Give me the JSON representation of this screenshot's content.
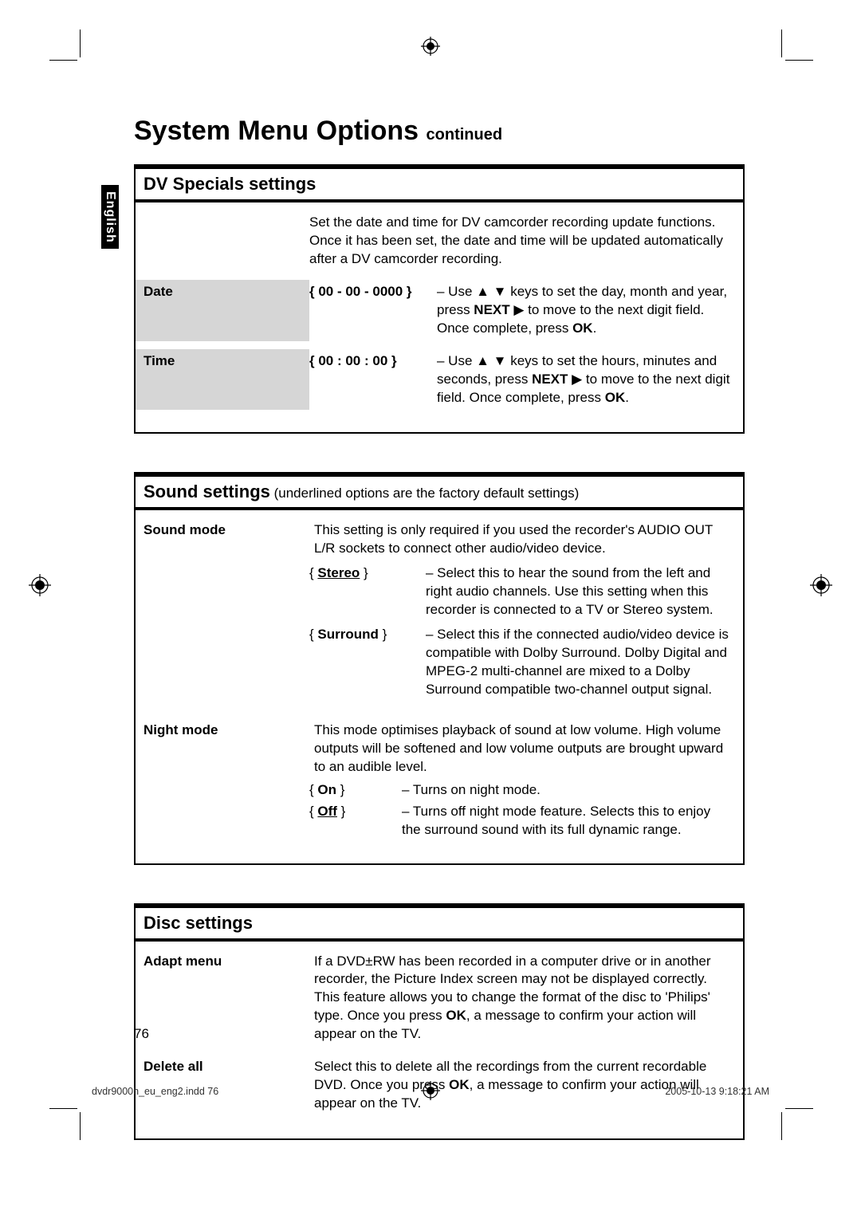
{
  "sideTab": "English",
  "pageTitle": "System Menu Options",
  "pageTitleSub": "continued",
  "box1": {
    "header": "DV Specials settings",
    "intro": "Set the date and time for DV camcorder recording update functions. Once it has been set, the date and time will be updated automatically after a DV camcorder recording.",
    "r1Label": "Date",
    "r1Value": "{ 00 - 00 - 0000 }",
    "r1Desc1": "–  Use ▲ ▼ keys to set the day, month and year, press ",
    "r1Desc1b": "NEXT",
    "r1Desc1c": " ▶  to move to the next digit field. Once complete, press ",
    "r1Desc1d": "OK",
    "r1Desc1e": ".",
    "r2Label": "Time",
    "r2Value": "{ 00 : 00 : 00 }",
    "r2Desc1": "–  Use ▲ ▼ keys to set the hours, minutes and seconds, press ",
    "r2Desc1b": "NEXT",
    "r2Desc1c": " ▶  to move to the next digit field. Once complete, press ",
    "r2Desc1d": "OK",
    "r2Desc1e": "."
  },
  "box2": {
    "headerBold": "Sound settings",
    "headerParen": " (underlined options are the factory default settings)",
    "smLabel": "Sound mode",
    "smIntro": "This setting is only required if you used the recorder's AUDIO OUT L/R sockets to connect other audio/video device.",
    "smOpt1": "Stereo",
    "smOpt1Desc": "–  Select this to hear the sound from the left and right audio channels. Use this setting when this recorder is connected to a TV or Stereo system.",
    "smOpt2": "Surround",
    "smOpt2Desc": "–  Select this if the connected audio/video device is compatible with Dolby Surround. Dolby Digital and MPEG-2 multi-channel are mixed to a Dolby Surround compatible two-channel output signal.",
    "nmLabel": "Night mode",
    "nmIntro": "This mode optimises playback of sound at low volume. High volume outputs will be softened and low volume outputs are brought upward to an audible level.",
    "nmOpt1": "On",
    "nmOpt1Desc": "–  Turns on night mode.",
    "nmOpt2": "Off",
    "nmOpt2Desc": "–  Turns off night mode feature. Selects this to enjoy the surround sound with its full dynamic range."
  },
  "box3": {
    "header": "Disc settings",
    "amLabel": "Adapt menu",
    "amDesc1": "If a DVD±RW has been recorded in a computer drive or in another recorder, the Picture Index screen may not be displayed correctly. This feature allows you to change the format of the disc to 'Philips' type. Once you press ",
    "amDesc1b": "OK",
    "amDesc1c": ", a message to confirm your action will appear on the TV.",
    "daLabel": "Delete all",
    "daDesc1": "Select this to delete all the recordings from the current recordable DVD. Once you press ",
    "daDesc1b": "OK",
    "daDesc1c": ", a message to confirm your action will appear on the TV."
  },
  "pageNumber": "76",
  "footerLeft": "dvdr9000h_eu_eng2.indd   76",
  "footerRight": "2005-10-13   9:18:21 AM"
}
